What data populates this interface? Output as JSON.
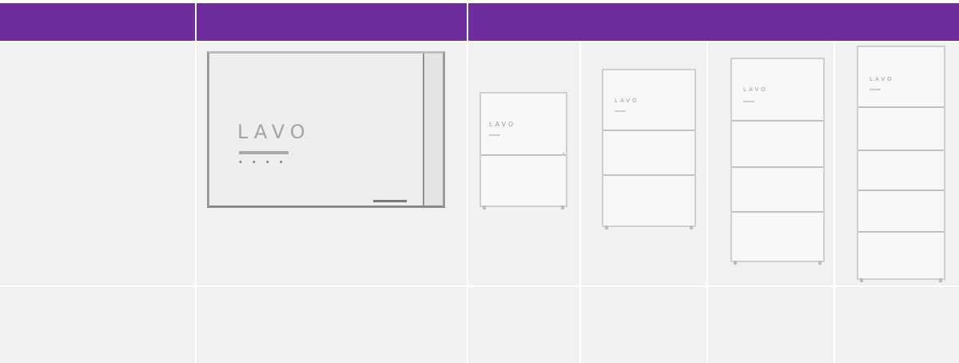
{
  "header": {
    "col1": "",
    "col2": "",
    "col3": ""
  },
  "row1": {
    "label": "",
    "hydrogen_unit": {
      "logo_text": "LAVO",
      "label_dots": "• • • •"
    },
    "battery_units": [
      {
        "brand": "LAVO",
        "modules": 1
      },
      {
        "brand": "LAVO",
        "modules": 2
      },
      {
        "brand": "LAVO",
        "modules": 3
      },
      {
        "brand": "LAVO",
        "modules": 4
      }
    ]
  },
  "row2": {
    "label": "",
    "cells": [
      "",
      "",
      "",
      "",
      ""
    ]
  },
  "colors": {
    "header": "#6f2c9c",
    "cell": "#f1f1f1",
    "grid": "#ffffff"
  }
}
